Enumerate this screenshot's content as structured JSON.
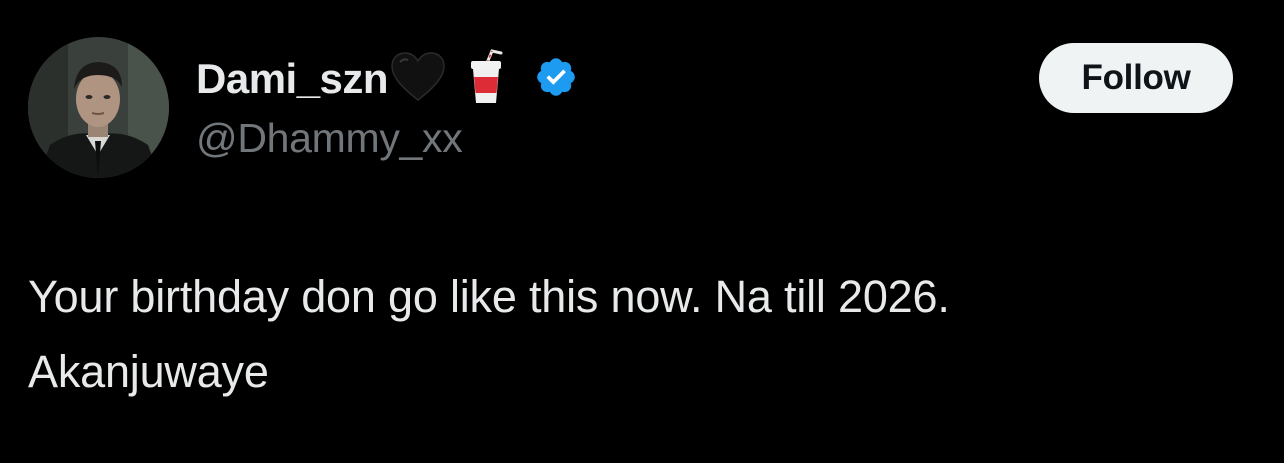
{
  "author": {
    "display_name": "Dami_szn",
    "name_emojis": [
      "black-heart",
      "cup-with-straw"
    ],
    "verified": true,
    "handle": "@Dhammy_xx"
  },
  "actions": {
    "follow_label": "Follow"
  },
  "tweet": {
    "lines": [
      "Your birthday don go like this now. Na till 2026.",
      "Akanjuwaye"
    ]
  },
  "colors": {
    "background": "#000000",
    "primary_text": "#e7e9ea",
    "secondary_text": "#71767b",
    "verified_blue": "#1d9bf0",
    "follow_button_bg": "#eff3f4",
    "follow_button_text": "#0f1419"
  }
}
